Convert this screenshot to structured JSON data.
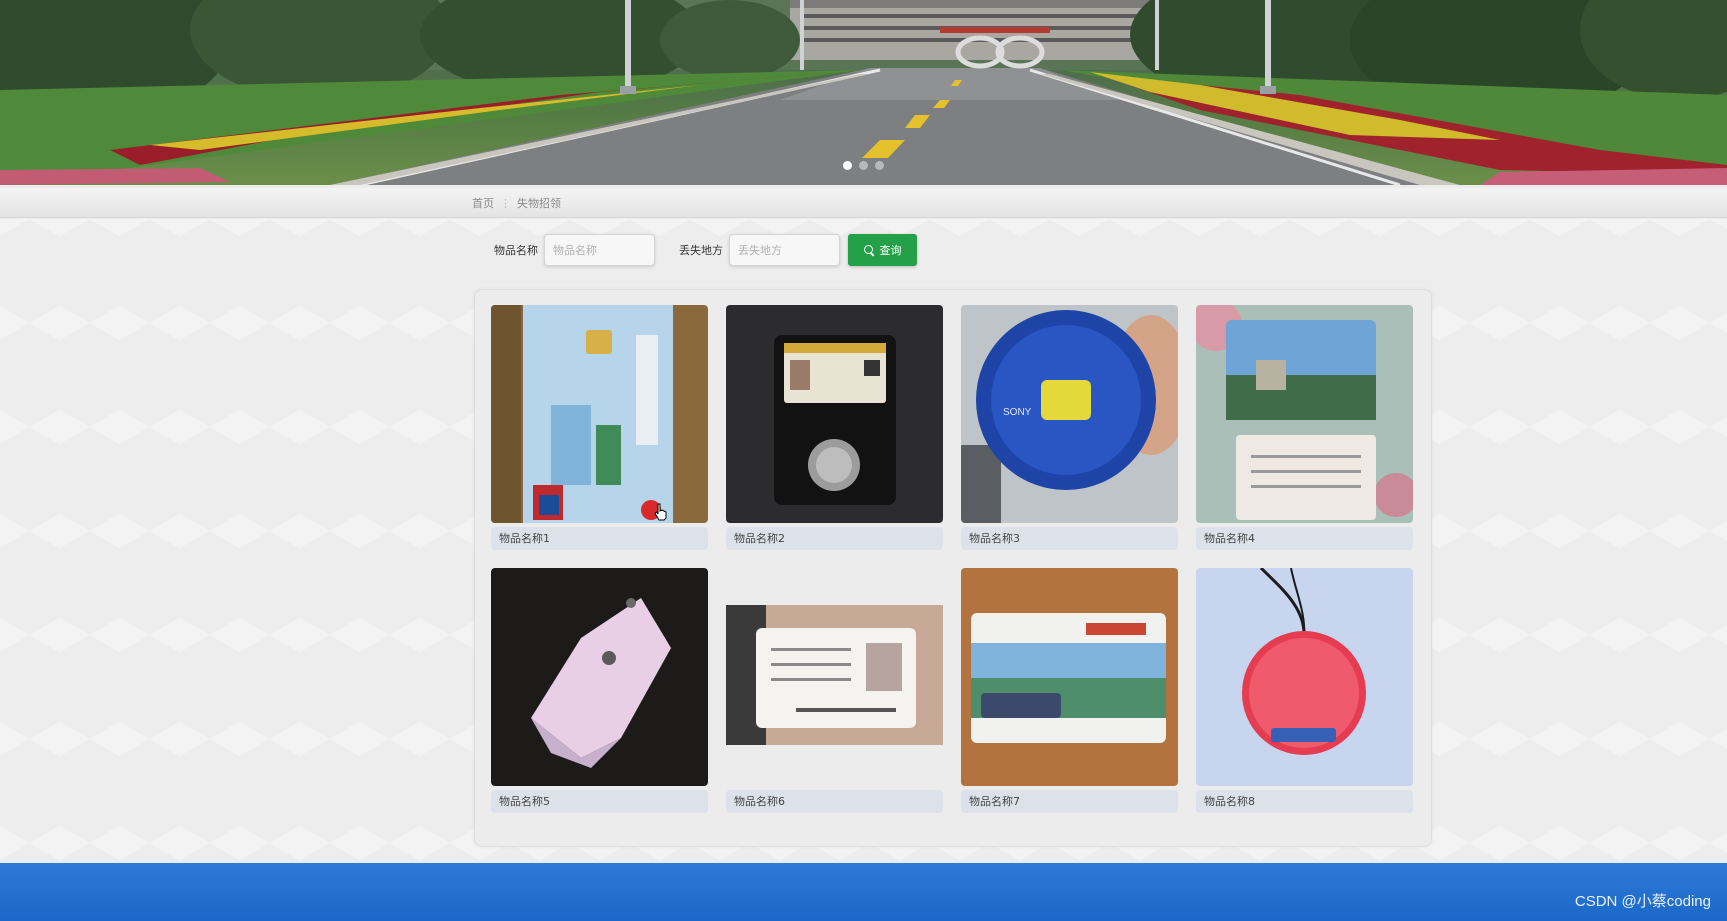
{
  "banner": {
    "slides": 3,
    "active_slide": 1,
    "image": "campus-road-photo"
  },
  "breadcrumb": {
    "home": "首页",
    "separator": "⋮",
    "current": "失物招领"
  },
  "search": {
    "name_label": "物品名称",
    "name_placeholder": "物品名称",
    "place_label": "丢失地方",
    "place_placeholder": "丢失地方",
    "button_label": "查询",
    "button_icon": "search-icon",
    "button_color": "#24a148"
  },
  "items": [
    {
      "name": "物品名称1",
      "image": "bank-card-photo"
    },
    {
      "name": "物品名称2",
      "image": "id-badge-wallet-photo"
    },
    {
      "name": "物品名称3",
      "image": "blue-sony-case-photo"
    },
    {
      "name": "物品名称4",
      "image": "transit-card-photo"
    },
    {
      "name": "物品名称5",
      "image": "pink-key-pouch-photo"
    },
    {
      "name": "物品名称6",
      "image": "id-card-in-hand-photo"
    },
    {
      "name": "物品名称7",
      "image": "bus-card-photo"
    },
    {
      "name": "物品名称8",
      "image": "red-round-tag-photo"
    }
  ],
  "footer": {
    "color": "#1b68c8",
    "watermark": "CSDN @小蔡coding"
  }
}
